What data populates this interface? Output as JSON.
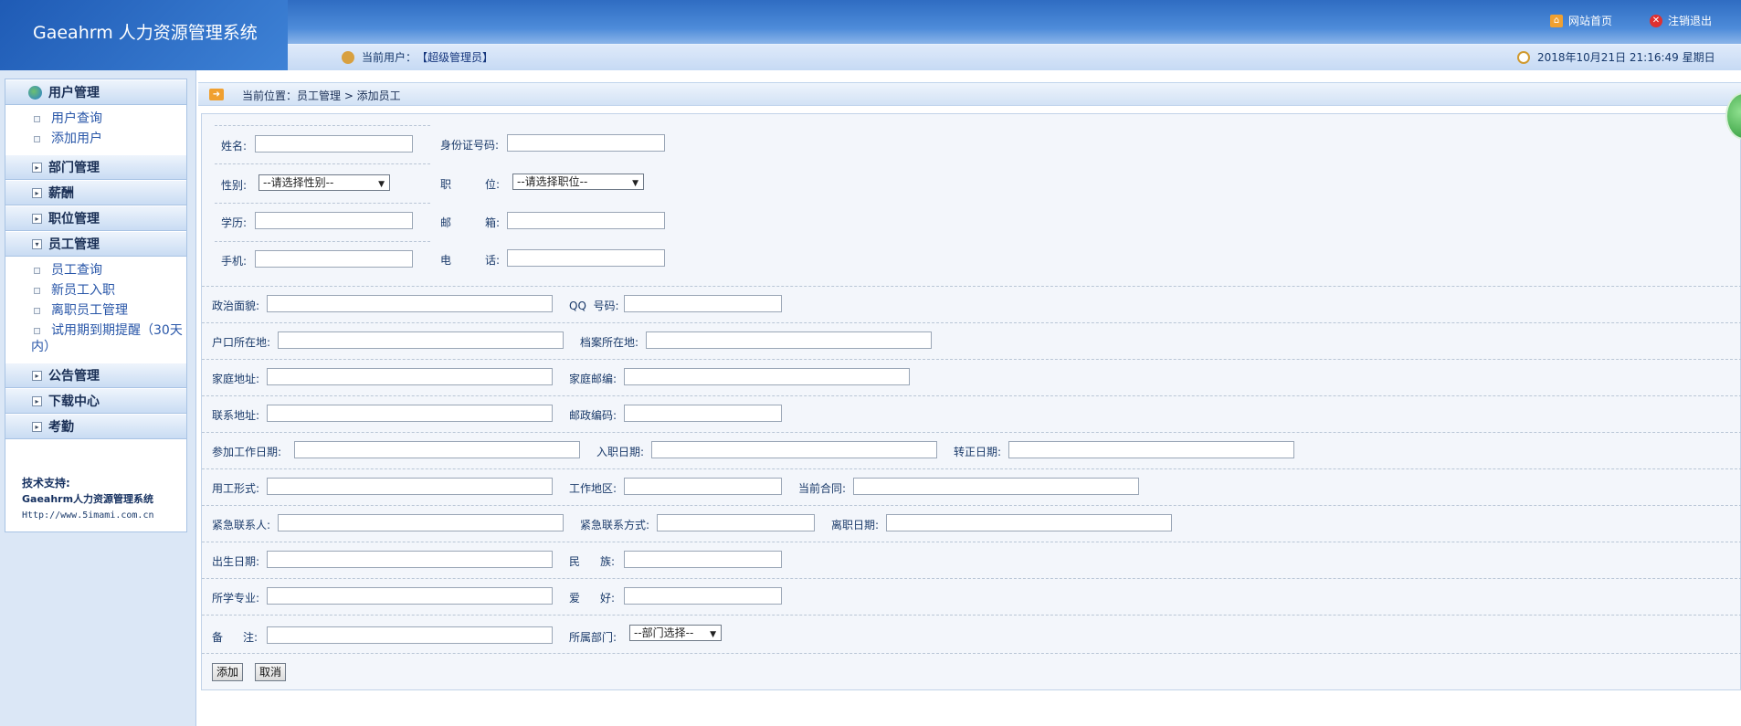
{
  "header": {
    "app_title": "Gaeahrm 人力资源管理系统",
    "home_label": "网站首页",
    "logout_label": "注销退出",
    "user_prefix": "当前用户：",
    "user_name": "【超级管理员】",
    "datetime": "2018年10月21日 21:16:49 星期日"
  },
  "sidebar": {
    "menus": [
      {
        "label": "用户管理",
        "items": [
          "用户查询",
          "添加用户"
        ]
      },
      {
        "label": "部门管理"
      },
      {
        "label": "薪酬"
      },
      {
        "label": "职位管理"
      },
      {
        "label": "员工管理",
        "items": [
          "员工查询",
          "新员工入职",
          "离职员工管理",
          "试用期到期提醒（30天内）"
        ]
      },
      {
        "label": "公告管理"
      },
      {
        "label": "下载中心"
      },
      {
        "label": "考勤"
      }
    ],
    "support": {
      "title": "技术支持:",
      "company": "Gaeahrm人力资源管理系统",
      "url": "Http://www.5imami.com.cn"
    }
  },
  "breadcrumb": {
    "text": "当前位置：员工管理 > 添加员工"
  },
  "form": {
    "name_label": "姓名:",
    "idcard_label": "身份证号码:",
    "gender_label": "性别:",
    "gender_value": "--请选择性别--",
    "position_label_1": "职",
    "position_label_2": "位:",
    "position_value": "--请选择职位--",
    "education_label": "学历:",
    "email_label_1": "邮",
    "email_label_2": "箱:",
    "mobile_label": "手机:",
    "phone_label_1": "电",
    "phone_label_2": "话:",
    "politics_label": "政治面貌:",
    "qq_label": "QQ  号码:",
    "hukou_label": "户口所在地:",
    "archive_label": "档案所在地:",
    "home_addr_label": "家庭地址:",
    "home_zip_label": "家庭邮编:",
    "contact_addr_label": "联系地址:",
    "zip_label": "邮政编码:",
    "work_start_label": "参加工作日期:",
    "join_date_label": "入职日期:",
    "regular_date_label": "转正日期:",
    "employ_type_label": "用工形式:",
    "work_area_label": "工作地区:",
    "contract_label": "当前合同:",
    "emergency_label": "紧急联系人:",
    "emergency_phone_label": "紧急联系方式:",
    "leave_date_label": "离职日期:",
    "birth_label": "出生日期:",
    "ethnic_label_1": "民",
    "ethnic_label_2": "族:",
    "major_label": "所学专业:",
    "hobby_label_1": "爱",
    "hobby_label_2": "好:",
    "remark_label_1": "备",
    "remark_label_2": "注:",
    "dept_label": "所属部门:",
    "dept_value": "--部门选择--",
    "add_button": "添加",
    "cancel_button": "取消"
  }
}
